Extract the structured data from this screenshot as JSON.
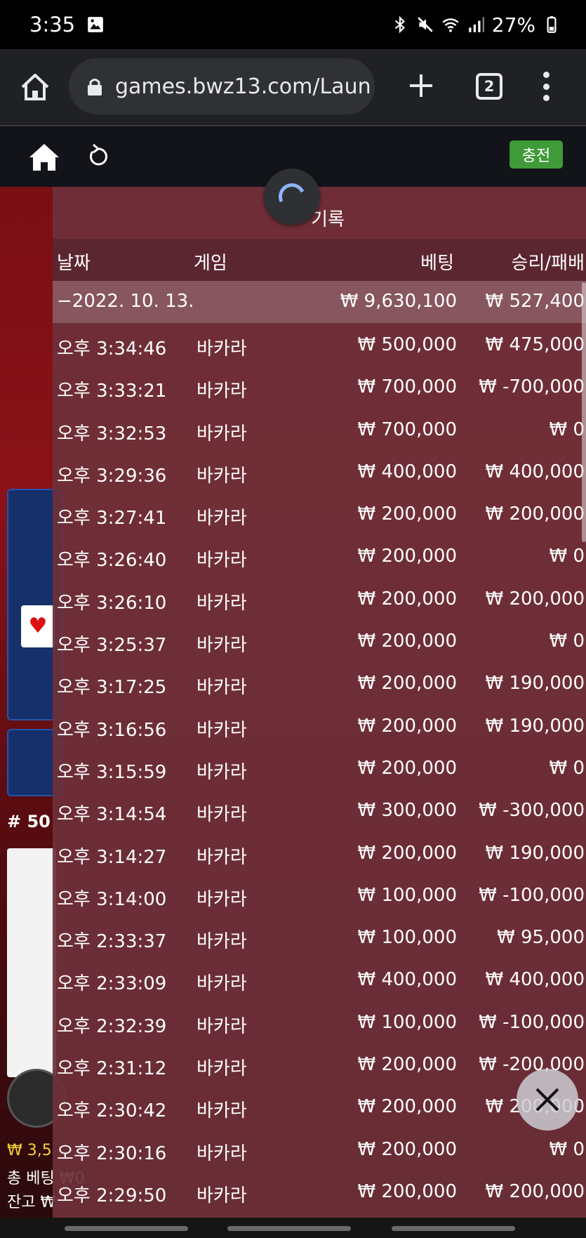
{
  "status_bar": {
    "time": "3:35",
    "battery": "27%",
    "icons": [
      "image-icon",
      "bluetooth-icon",
      "mute-icon",
      "wifi-icon",
      "signal-icon",
      "battery-icon"
    ]
  },
  "browser": {
    "url": "games.bwz13.com/Laun",
    "tab_count": "2"
  },
  "game_header": {
    "charge_label": "충전"
  },
  "background": {
    "round_label": "# 50",
    "balance_line1": "₩ 3,5",
    "balance_line2": "총 베팅 ₩0",
    "balance_line3": "잔고 ₩"
  },
  "history": {
    "title": "기록",
    "columns": {
      "date": "날짜",
      "game": "게임",
      "bet": "베팅",
      "win": "승리/패배"
    },
    "summary": {
      "date": "−2022. 10. 13.",
      "bet": "₩ 9,630,100",
      "win": "₩ 527,400"
    },
    "rows": [
      {
        "time": "오후 3:34:46",
        "game": "바카라",
        "bet": "₩ 500,000",
        "win": "₩ 475,000"
      },
      {
        "time": "오후 3:33:21",
        "game": "바카라",
        "bet": "₩ 700,000",
        "win": "₩ -700,000"
      },
      {
        "time": "오후 3:32:53",
        "game": "바카라",
        "bet": "₩ 700,000",
        "win": "₩ 0"
      },
      {
        "time": "오후 3:29:36",
        "game": "바카라",
        "bet": "₩ 400,000",
        "win": "₩ 400,000"
      },
      {
        "time": "오후 3:27:41",
        "game": "바카라",
        "bet": "₩ 200,000",
        "win": "₩ 200,000"
      },
      {
        "time": "오후 3:26:40",
        "game": "바카라",
        "bet": "₩ 200,000",
        "win": "₩ 0"
      },
      {
        "time": "오후 3:26:10",
        "game": "바카라",
        "bet": "₩ 200,000",
        "win": "₩ 200,000"
      },
      {
        "time": "오후 3:25:37",
        "game": "바카라",
        "bet": "₩ 200,000",
        "win": "₩ 0"
      },
      {
        "time": "오후 3:17:25",
        "game": "바카라",
        "bet": "₩ 200,000",
        "win": "₩ 190,000"
      },
      {
        "time": "오후 3:16:56",
        "game": "바카라",
        "bet": "₩ 200,000",
        "win": "₩ 190,000"
      },
      {
        "time": "오후 3:15:59",
        "game": "바카라",
        "bet": "₩ 200,000",
        "win": "₩ 0"
      },
      {
        "time": "오후 3:14:54",
        "game": "바카라",
        "bet": "₩ 300,000",
        "win": "₩ -300,000"
      },
      {
        "time": "오후 3:14:27",
        "game": "바카라",
        "bet": "₩ 200,000",
        "win": "₩ 190,000"
      },
      {
        "time": "오후 3:14:00",
        "game": "바카라",
        "bet": "₩ 100,000",
        "win": "₩ -100,000"
      },
      {
        "time": "오후 2:33:37",
        "game": "바카라",
        "bet": "₩ 100,000",
        "win": "₩ 95,000"
      },
      {
        "time": "오후 2:33:09",
        "game": "바카라",
        "bet": "₩ 400,000",
        "win": "₩ 400,000"
      },
      {
        "time": "오후 2:32:39",
        "game": "바카라",
        "bet": "₩ 100,000",
        "win": "₩ -100,000"
      },
      {
        "time": "오후 2:31:12",
        "game": "바카라",
        "bet": "₩ 200,000",
        "win": "₩ -200,000"
      },
      {
        "time": "오후 2:30:42",
        "game": "바카라",
        "bet": "₩ 200,000",
        "win": "₩ 200,000"
      },
      {
        "time": "오후 2:30:16",
        "game": "바카라",
        "bet": "₩ 200,000",
        "win": "₩ 0"
      },
      {
        "time": "오후 2:29:50",
        "game": "바카라",
        "bet": "₩ 200,000",
        "win": "₩ 200,000"
      }
    ]
  },
  "colors": {
    "panel": "#6e303a",
    "charge_button": "#3f9a38",
    "browser_bar": "#202124",
    "spinner": "#8ab4f8"
  }
}
